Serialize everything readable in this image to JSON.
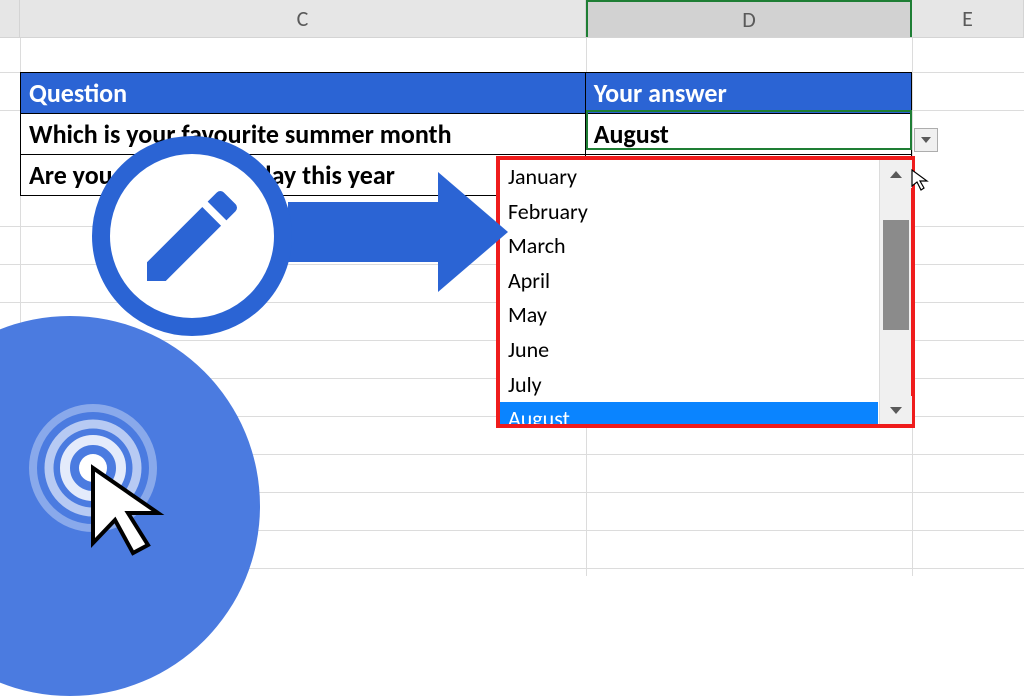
{
  "columns": {
    "c": "C",
    "d": "D",
    "e": "E"
  },
  "table": {
    "header": {
      "question": "Question",
      "answer": "Your answer"
    },
    "rows": [
      {
        "question": "Which is your favourite summer month",
        "answer": "August"
      },
      {
        "question": "Are you going on holiday this year",
        "answer": ""
      }
    ]
  },
  "dropdown": {
    "items": [
      "January",
      "February",
      "March",
      "April",
      "May",
      "June",
      "July",
      "August"
    ],
    "selected": "August"
  },
  "colors": {
    "accent": "#2b64d4",
    "highlight_border": "#ef1c1c",
    "selection": "#0a84ff"
  }
}
